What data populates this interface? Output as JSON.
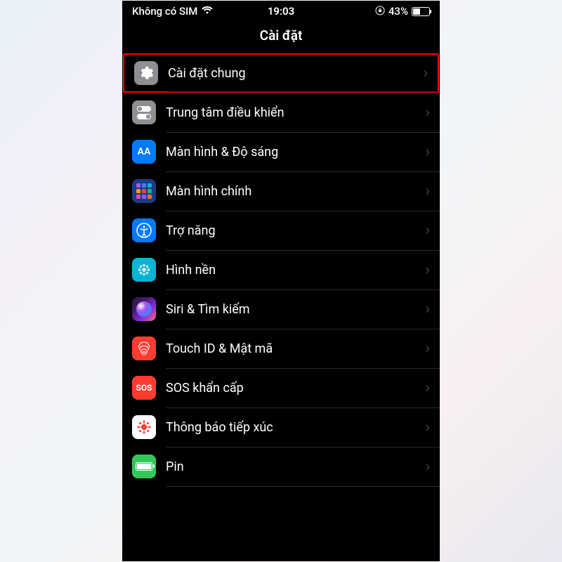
{
  "statusBar": {
    "carrier": "Không có SIM",
    "time": "19:03",
    "battery": "43%",
    "batteryLevel": 43
  },
  "header": {
    "title": "Cài đặt"
  },
  "rows": [
    {
      "label": "Cài đặt chung",
      "icon": "gear",
      "highlighted": true
    },
    {
      "label": "Trung tâm điều khiển",
      "icon": "control-center"
    },
    {
      "label": "Màn hình & Độ sáng",
      "icon": "display"
    },
    {
      "label": "Màn hình chính",
      "icon": "home-screen"
    },
    {
      "label": "Trợ năng",
      "icon": "accessibility"
    },
    {
      "label": "Hình nền",
      "icon": "wallpaper"
    },
    {
      "label": "Siri & Tìm kiếm",
      "icon": "siri"
    },
    {
      "label": "Touch ID & Mật mã",
      "icon": "touch-id"
    },
    {
      "label": "SOS khẩn cấp",
      "icon": "sos"
    },
    {
      "label": "Thông báo tiếp xúc",
      "icon": "exposure"
    },
    {
      "label": "Pin",
      "icon": "battery"
    }
  ]
}
